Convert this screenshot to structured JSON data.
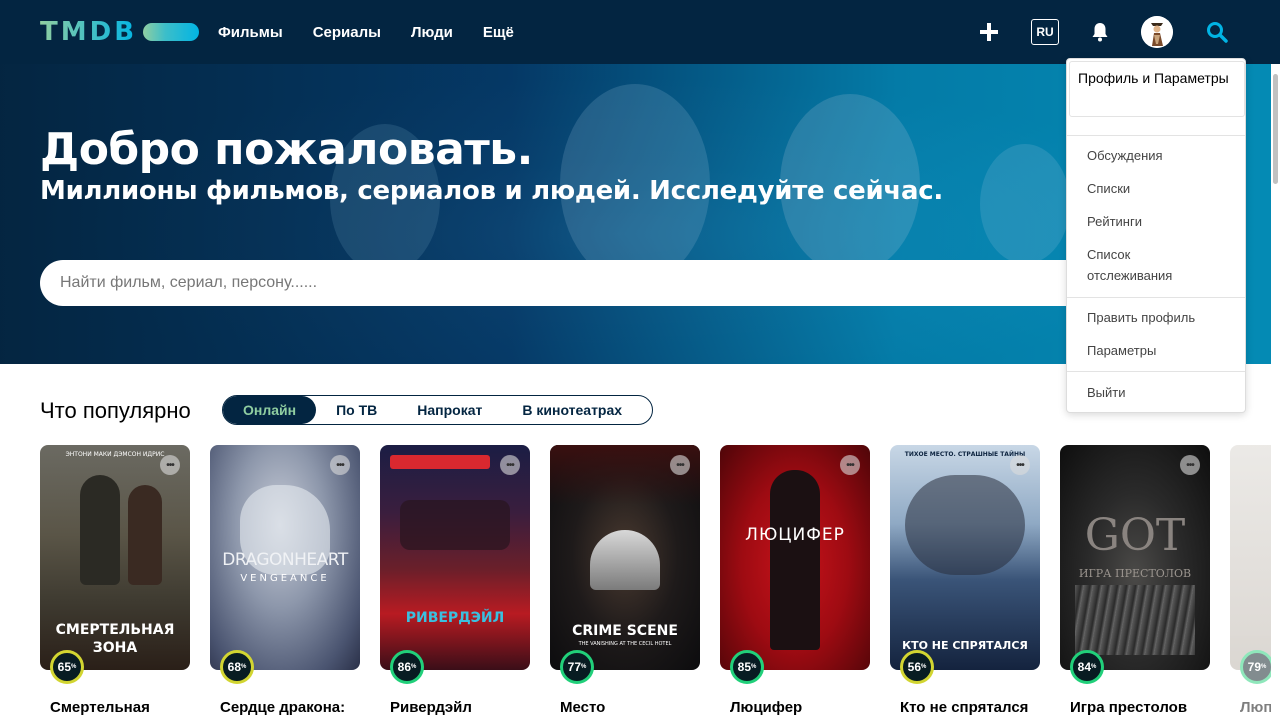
{
  "header": {
    "logo_text": "TMDB",
    "nav": [
      "Фильмы",
      "Сериалы",
      "Люди",
      "Ещё"
    ],
    "lang": "RU",
    "icons": [
      "plus-icon",
      "bell-icon",
      "avatar",
      "search-icon"
    ]
  },
  "hero": {
    "title": "Добро пожаловать.",
    "subtitle": "Миллионы фильмов, сериалов и людей. Исследуйте сейчас.",
    "search_placeholder": "Найти фильм, сериал, персону......"
  },
  "trending": {
    "title": "Что популярно",
    "tabs": [
      "Онлайн",
      "По ТВ",
      "Напрокат",
      "В кинотеатрах"
    ],
    "active_tab": "Онлайн",
    "cards": [
      {
        "name": "Смертельная",
        "score": "65",
        "poster_text": "СМЕРТЕЛЬНАЯ ЗОНА",
        "poster_top": "ЭНТОНИ МАКИ   ДЭМСОН ИДРИС",
        "rating_color": "#d2d531"
      },
      {
        "name": "Сердце дракона:",
        "score": "68",
        "poster_text": "DRAGONHEART",
        "poster_sub": "VENGEANCE",
        "rating_color": "#d2d531"
      },
      {
        "name": "Ривердэйл",
        "score": "86",
        "poster_text": "РИВЕРДЭЙЛ",
        "rating_color": "#21d07a"
      },
      {
        "name": "Место",
        "score": "77",
        "poster_text": "CRIME SCENE",
        "poster_sub": "THE VANISHING AT THE CECIL HOTEL",
        "rating_color": "#21d07a"
      },
      {
        "name": "Люцифер",
        "score": "85",
        "poster_text": "ЛЮЦИФЕР",
        "rating_color": "#21d07a"
      },
      {
        "name": "Кто не спрятался",
        "score": "56",
        "poster_text": "КТО НЕ СПРЯТАЛСЯ",
        "poster_top": "ТИХОЕ МЕСТО. СТРАШНЫЕ ТАЙНЫ",
        "rating_color": "#d2d531"
      },
      {
        "name": "Игра престолов",
        "score": "84",
        "poster_text": "GOT",
        "poster_sub": "ИГРА ПРЕСТОЛОВ",
        "rating_color": "#21d07a"
      },
      {
        "name": "Люп",
        "score": "79",
        "rating_color": "#21d07a"
      }
    ]
  },
  "user_menu": {
    "profile": "Профиль и Параметры",
    "items": [
      "Обсуждения",
      "Списки",
      "Рейтинги",
      "Список отслеживания"
    ],
    "items2": [
      "Править профиль",
      "Параметры"
    ],
    "logout": "Выйти"
  },
  "colors": {
    "header_bg": "#032541",
    "accent_green": "#90cea1",
    "accent_blue": "#01b4e4"
  }
}
